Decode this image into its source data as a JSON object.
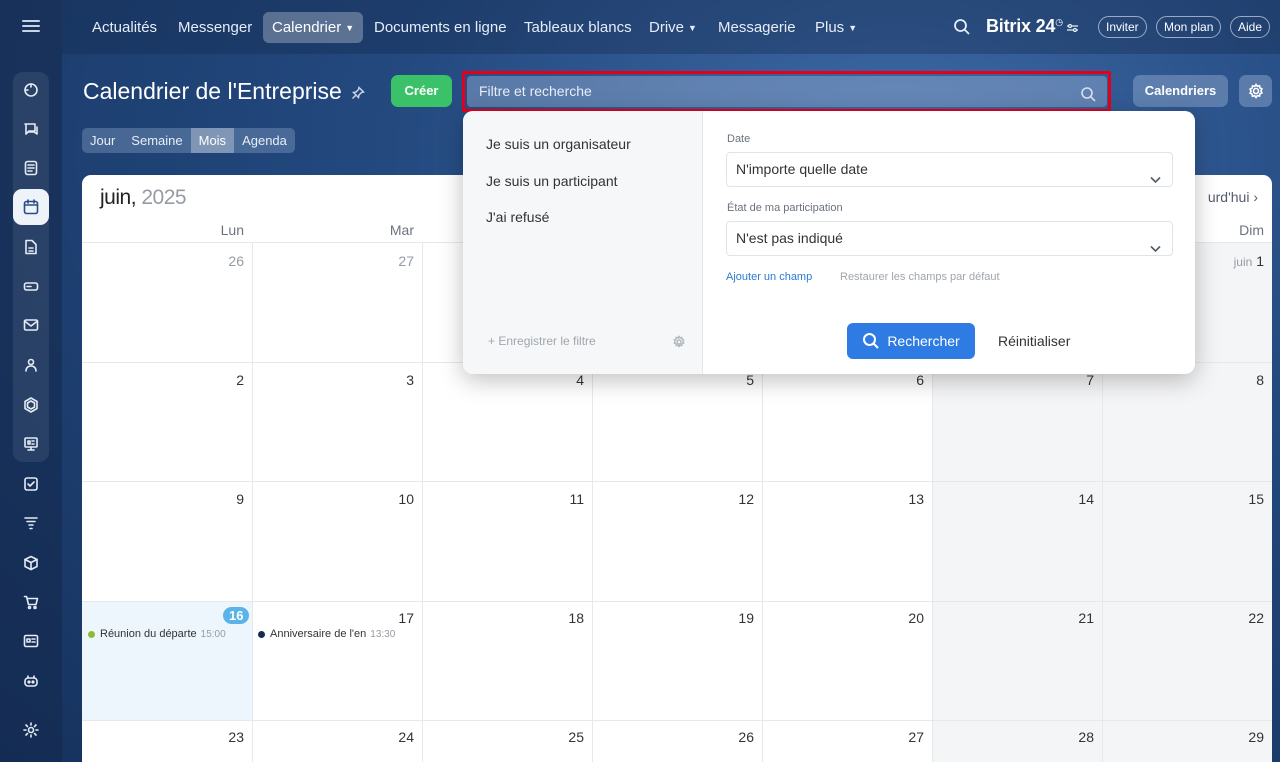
{
  "nav": {
    "items": [
      {
        "label": "Actualités"
      },
      {
        "label": "Messenger"
      },
      {
        "label": "Calendrier"
      },
      {
        "label": "Documents en ligne"
      },
      {
        "label": "Tableaux blancs"
      },
      {
        "label": "Drive"
      },
      {
        "label": "Messagerie"
      },
      {
        "label": "Plus"
      }
    ],
    "brand": "Bitrix 24",
    "invite": "Inviter",
    "plan": "Mon plan",
    "help": "Aide"
  },
  "page": {
    "title": "Calendrier de l'Entreprise",
    "create": "Créer",
    "search_placeholder": "Filtre et recherche",
    "calendars": "Calendriers"
  },
  "views": [
    "Jour",
    "Semaine",
    "Mois",
    "Agenda"
  ],
  "calendar": {
    "month": "juin,",
    "year": "2025",
    "today_link": "urd'hui",
    "weekdays": [
      "Lun",
      "Mar",
      "",
      "",
      "",
      "",
      "Dim"
    ],
    "first_label": "juin",
    "weeks": [
      [
        "26",
        "27",
        "",
        "",
        "",
        "",
        "1"
      ],
      [
        "2",
        "3",
        "4",
        "5",
        "6",
        "7",
        "8"
      ],
      [
        "9",
        "10",
        "11",
        "12",
        "13",
        "14",
        "15"
      ],
      [
        "16",
        "17",
        "18",
        "19",
        "20",
        "21",
        "22"
      ],
      [
        "23",
        "24",
        "25",
        "26",
        "27",
        "28",
        "29"
      ]
    ],
    "events": [
      {
        "title": "Réunion du départe",
        "time": "15:00",
        "color": "#8dbb36"
      },
      {
        "title": "Anniversaire de l'en",
        "time": "13:30",
        "color": "#1a2b52"
      }
    ]
  },
  "filter": {
    "presets": [
      "Je suis un organisateur",
      "Je suis un participant",
      "J'ai refusé"
    ],
    "save": "Enregistrer le filtre",
    "date_label": "Date",
    "date_value": "N'importe quelle date",
    "participation_label": "État de ma participation",
    "participation_value": "N'est pas indiqué",
    "add_field": "Ajouter un champ",
    "restore": "Restaurer les champs par défaut",
    "search": "Rechercher",
    "reset": "Réinitialiser"
  },
  "colors": {
    "accent": "#2e7ce3",
    "create": "#3bc268",
    "highlight": "#e3001b",
    "today": "#5ab4e8"
  }
}
